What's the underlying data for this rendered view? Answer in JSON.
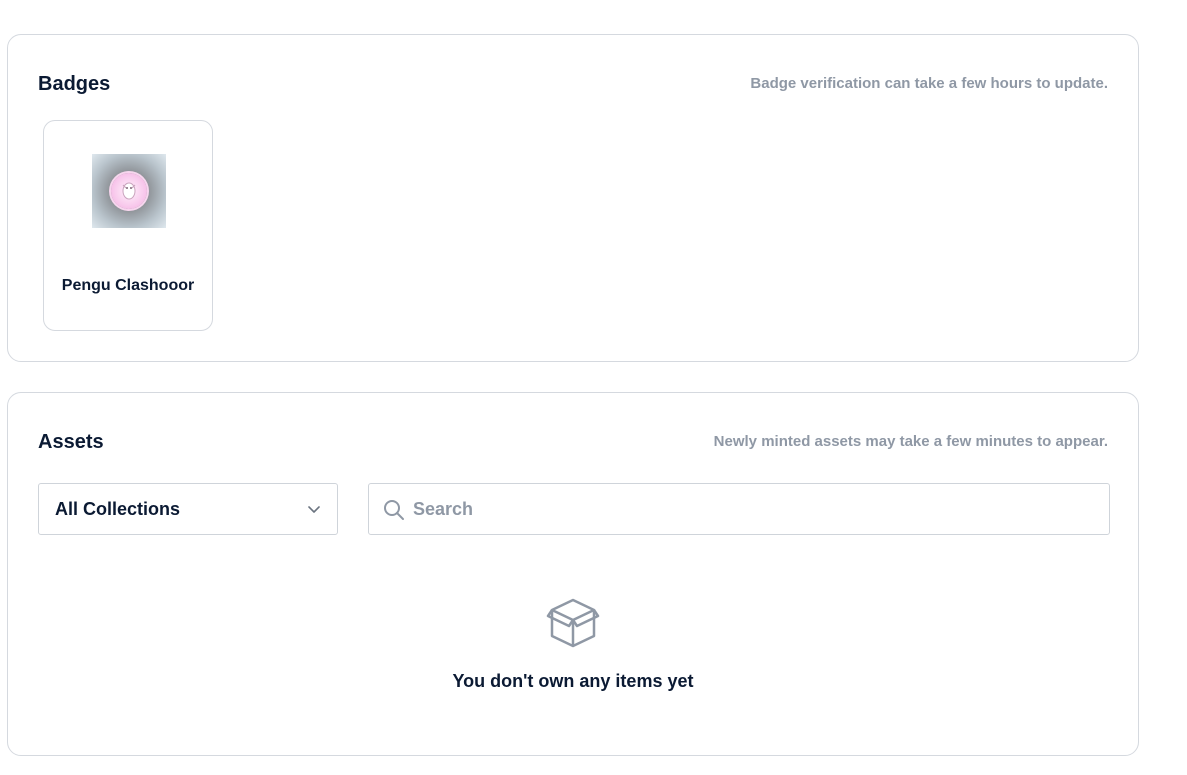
{
  "badges": {
    "title": "Badges",
    "note": "Badge verification can take a few hours to update.",
    "items": [
      {
        "name": "Pengu Clashooor"
      }
    ]
  },
  "assets": {
    "title": "Assets",
    "note": "Newly minted assets may take a few minutes to appear.",
    "filter": {
      "selected": "All Collections"
    },
    "search": {
      "placeholder": "Search",
      "value": ""
    },
    "empty_state": {
      "icon": "box-icon",
      "message": "You don't own any items yet"
    }
  },
  "colors": {
    "text_primary": "#0b1a33",
    "text_muted": "#8f98a5",
    "border": "#d5d9df"
  }
}
